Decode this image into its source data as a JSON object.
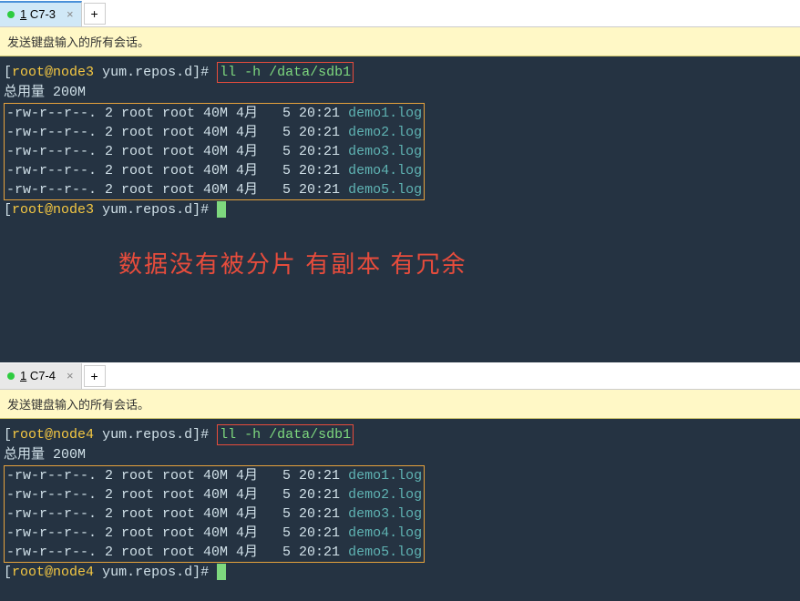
{
  "panes": {
    "top": {
      "tab": {
        "num": "1",
        "name": "C7-3",
        "active": true
      },
      "yellow_msg": "发送键盘输入的所有会话。",
      "prompt_user": "root",
      "prompt_host": "node3",
      "prompt_dir": "yum.repos.d",
      "command": "ll -h /data/sdb1",
      "total_label": "总用量",
      "total_size": "200M",
      "rows": [
        {
          "perm": "-rw-r--r--.",
          "links": "2",
          "own": "root",
          "grp": "root",
          "size": "40M",
          "mon": "4月",
          "day": "5",
          "time": "20:21",
          "name": "demo1.log"
        },
        {
          "perm": "-rw-r--r--.",
          "links": "2",
          "own": "root",
          "grp": "root",
          "size": "40M",
          "mon": "4月",
          "day": "5",
          "time": "20:21",
          "name": "demo2.log"
        },
        {
          "perm": "-rw-r--r--.",
          "links": "2",
          "own": "root",
          "grp": "root",
          "size": "40M",
          "mon": "4月",
          "day": "5",
          "time": "20:21",
          "name": "demo3.log"
        },
        {
          "perm": "-rw-r--r--.",
          "links": "2",
          "own": "root",
          "grp": "root",
          "size": "40M",
          "mon": "4月",
          "day": "5",
          "time": "20:21",
          "name": "demo4.log"
        },
        {
          "perm": "-rw-r--r--.",
          "links": "2",
          "own": "root",
          "grp": "root",
          "size": "40M",
          "mon": "4月",
          "day": "5",
          "time": "20:21",
          "name": "demo5.log"
        }
      ],
      "annotation": "数据没有被分片 有副本 有冗余"
    },
    "bottom": {
      "tab": {
        "num": "1",
        "name": "C7-4",
        "active": false
      },
      "yellow_msg": "发送键盘输入的所有会话。",
      "prompt_user": "root",
      "prompt_host": "node4",
      "prompt_dir": "yum.repos.d",
      "command": "ll -h /data/sdb1",
      "total_label": "总用量",
      "total_size": "200M",
      "rows": [
        {
          "perm": "-rw-r--r--.",
          "links": "2",
          "own": "root",
          "grp": "root",
          "size": "40M",
          "mon": "4月",
          "day": "5",
          "time": "20:21",
          "name": "demo1.log"
        },
        {
          "perm": "-rw-r--r--.",
          "links": "2",
          "own": "root",
          "grp": "root",
          "size": "40M",
          "mon": "4月",
          "day": "5",
          "time": "20:21",
          "name": "demo2.log"
        },
        {
          "perm": "-rw-r--r--.",
          "links": "2",
          "own": "root",
          "grp": "root",
          "size": "40M",
          "mon": "4月",
          "day": "5",
          "time": "20:21",
          "name": "demo3.log"
        },
        {
          "perm": "-rw-r--r--.",
          "links": "2",
          "own": "root",
          "grp": "root",
          "size": "40M",
          "mon": "4月",
          "day": "5",
          "time": "20:21",
          "name": "demo4.log"
        },
        {
          "perm": "-rw-r--r--.",
          "links": "2",
          "own": "root",
          "grp": "root",
          "size": "40M",
          "mon": "4月",
          "day": "5",
          "time": "20:21",
          "name": "demo5.log"
        }
      ]
    }
  }
}
